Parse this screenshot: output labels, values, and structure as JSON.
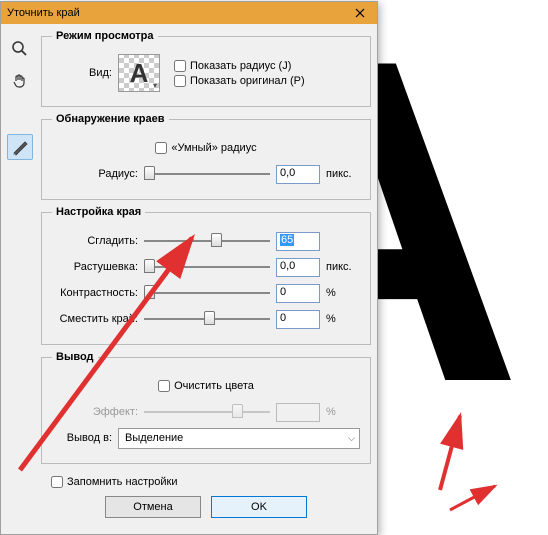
{
  "window": {
    "title": "Уточнить край"
  },
  "view": {
    "legend": "Режим просмотра",
    "vid_label": "Вид:",
    "show_radius": "Показать радиус (J)",
    "show_original": "Показать оригинал (P)"
  },
  "edge_detect": {
    "legend": "Обнаружение краев",
    "smart_radius": "«Умный» радиус",
    "radius_label": "Радиус:",
    "radius_value": "0,0",
    "radius_unit": "пикс."
  },
  "adjust": {
    "legend": "Настройка края",
    "smooth_label": "Сгладить:",
    "smooth_value": "65",
    "feather_label": "Растушевка:",
    "feather_value": "0,0",
    "feather_unit": "пикс.",
    "contrast_label": "Контрастность:",
    "contrast_value": "0",
    "contrast_unit": "%",
    "shift_label": "Сместить край:",
    "shift_value": "0",
    "shift_unit": "%"
  },
  "output": {
    "legend": "Вывод",
    "decontaminate": "Очистить цвета",
    "effect_label": "Эффект:",
    "effect_unit": "%",
    "output_to_label": "Вывод в:",
    "output_to_value": "Выделение"
  },
  "remember": "Запомнить настройки",
  "buttons": {
    "cancel": "Отмена",
    "ok": "OK"
  }
}
